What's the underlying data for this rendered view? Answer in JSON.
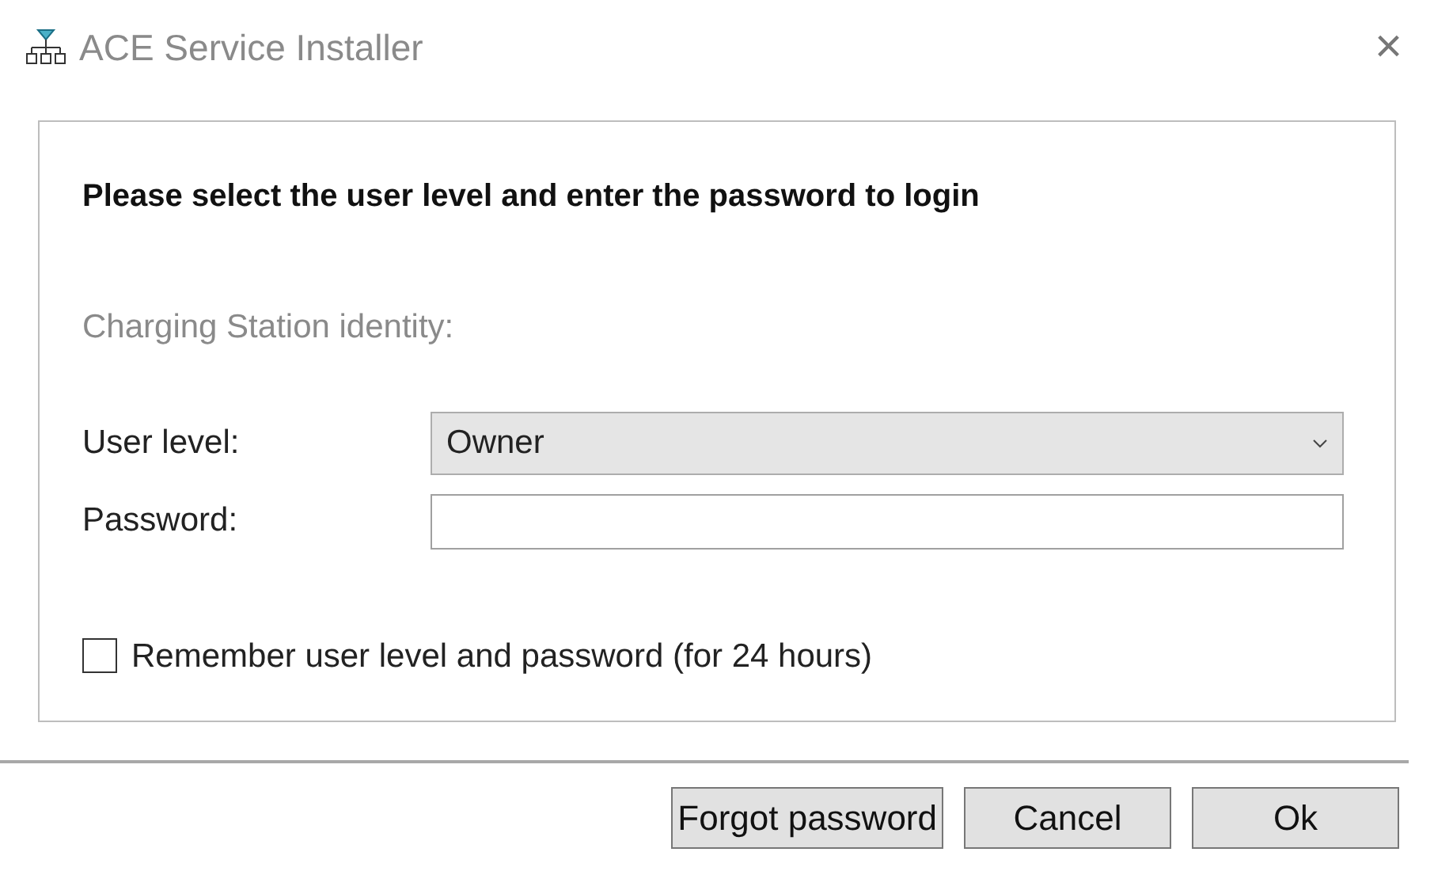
{
  "window": {
    "title": "ACE Service Installer",
    "close": "×"
  },
  "panel": {
    "heading": "Please select the user level and enter the password to login",
    "identity_label": "Charging Station identity:",
    "user_level": {
      "label": "User level:",
      "value": "Owner"
    },
    "password": {
      "label": "Password:"
    },
    "remember": {
      "label": "Remember user level and password (for 24 hours)",
      "checked": false
    }
  },
  "buttons": [
    "Forgot password",
    "Cancel",
    "Ok"
  ]
}
